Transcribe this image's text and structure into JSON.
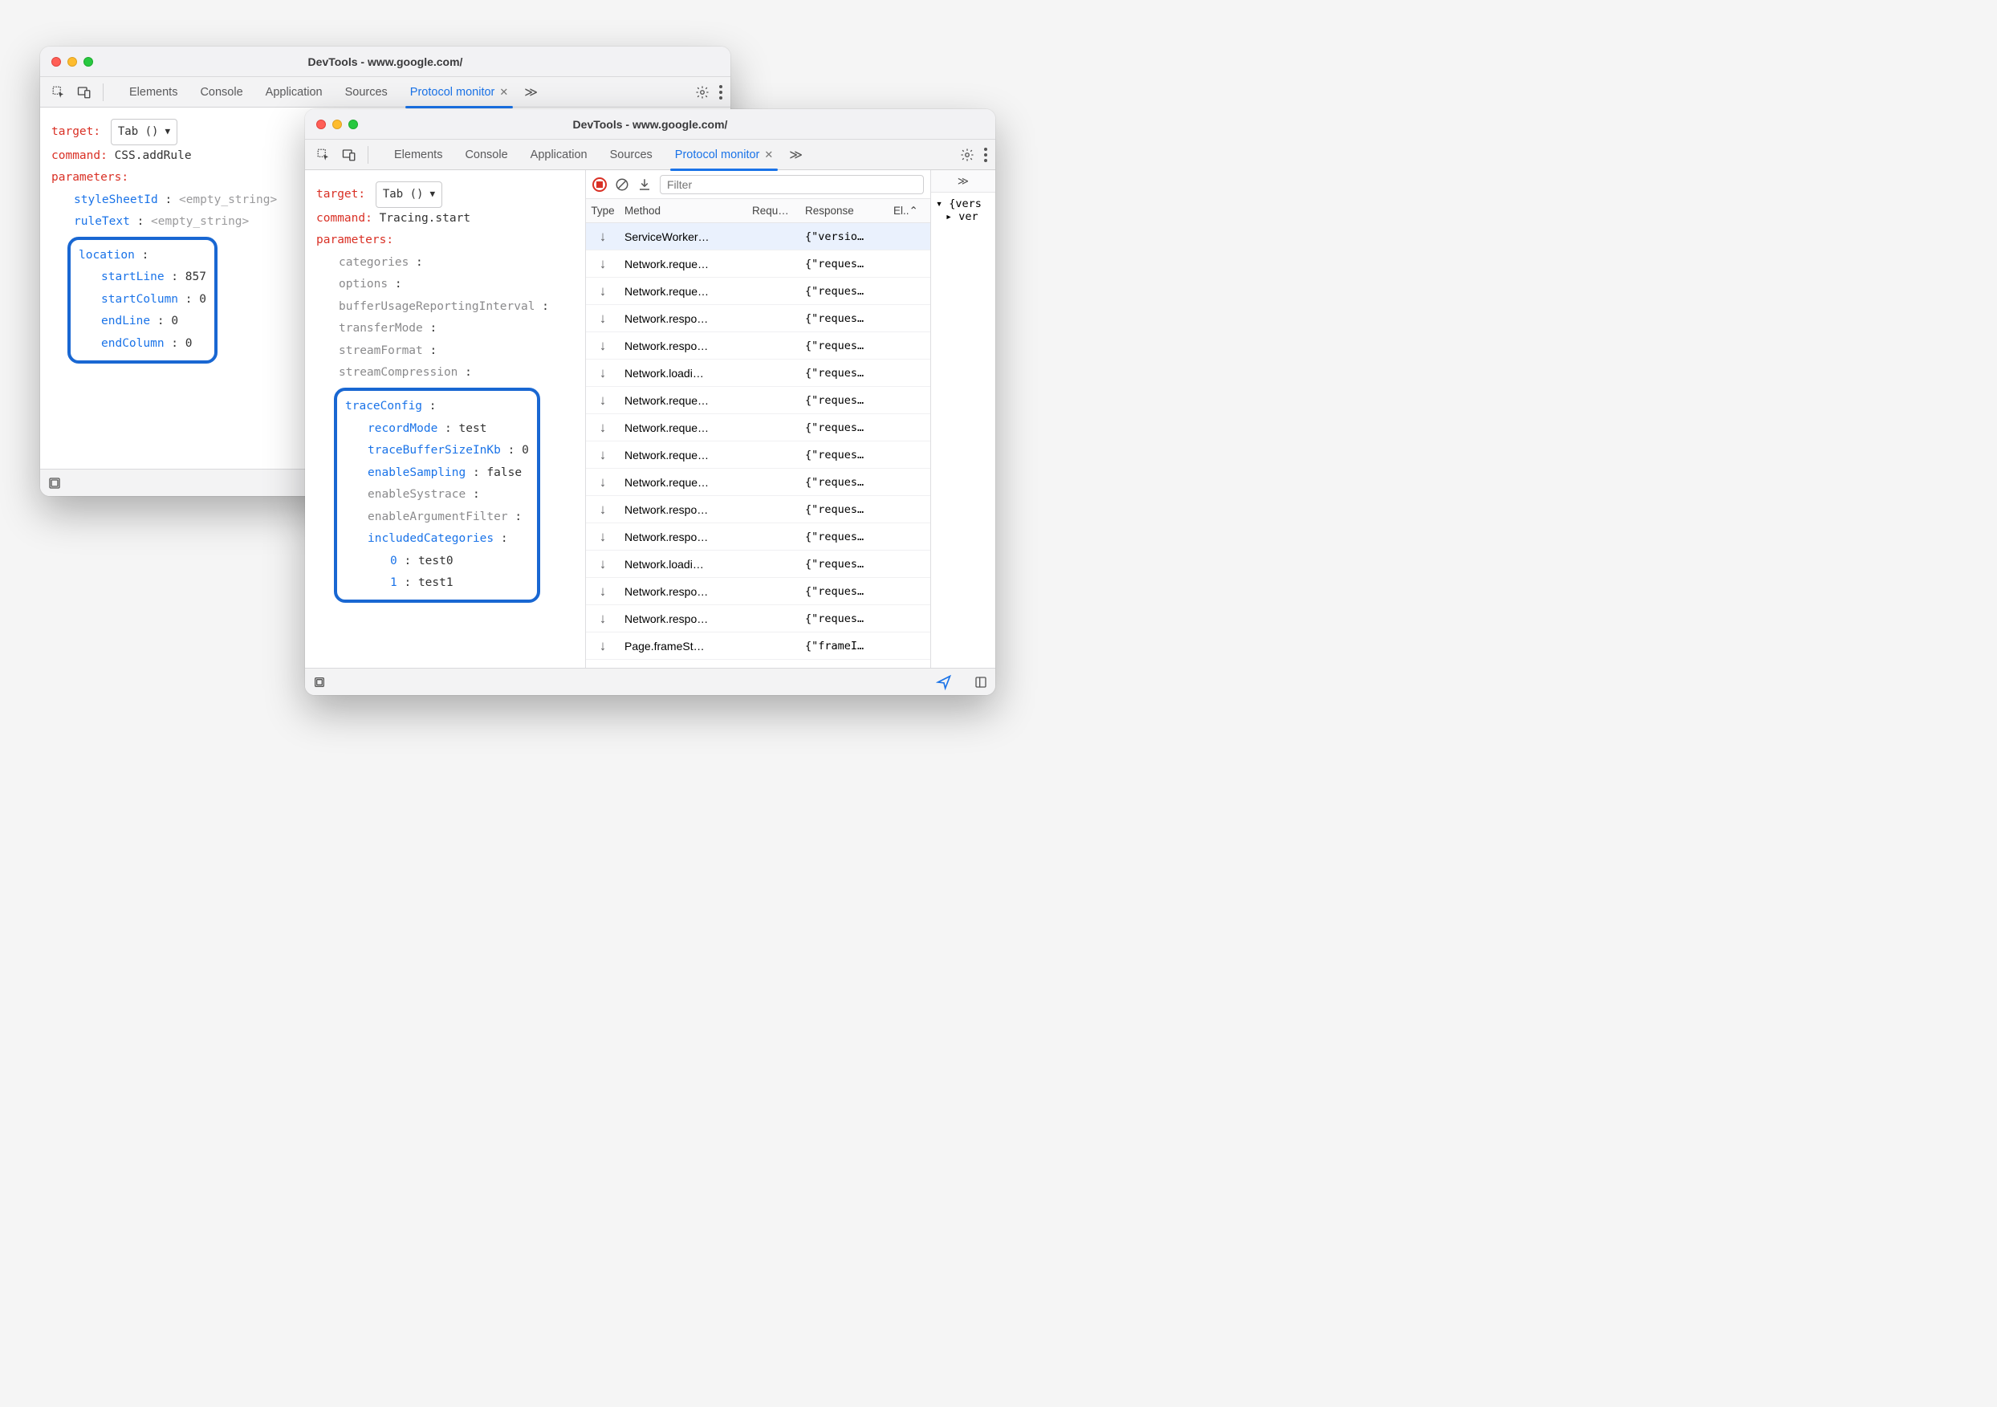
{
  "colors": {
    "accent": "#1a73e8",
    "danger": "#d93025",
    "highlight_border": "#1967d2"
  },
  "windowA": {
    "title": "DevTools - www.google.com/",
    "tabs": [
      "Elements",
      "Console",
      "Application",
      "Sources",
      "Protocol monitor"
    ],
    "active_tab": "Protocol monitor",
    "target_label": "target",
    "target_value": "Tab ()",
    "command_label": "command",
    "command_value": "CSS.addRule",
    "parameters_label": "parameters",
    "params_flat": [
      {
        "key": "styleSheetId",
        "value": "<empty_string>",
        "empty": true
      },
      {
        "key": "ruleText",
        "value": "<empty_string>",
        "empty": true
      }
    ],
    "highlight_key": "location",
    "highlight_props": [
      {
        "key": "startLine",
        "value": "857"
      },
      {
        "key": "startColumn",
        "value": "0"
      },
      {
        "key": "endLine",
        "value": "0"
      },
      {
        "key": "endColumn",
        "value": "0"
      }
    ]
  },
  "windowB": {
    "title": "DevTools - www.google.com/",
    "tabs": [
      "Elements",
      "Console",
      "Application",
      "Sources",
      "Protocol monitor"
    ],
    "active_tab": "Protocol monitor",
    "target_label": "target",
    "target_value": "Tab ()",
    "command_label": "command",
    "command_value": "Tracing.start",
    "parameters_label": "parameters",
    "params_flat": [
      {
        "key": "categories",
        "value": "",
        "gray": true
      },
      {
        "key": "options",
        "value": "",
        "gray": true
      },
      {
        "key": "bufferUsageReportingInterval",
        "value": "",
        "gray": true
      },
      {
        "key": "transferMode",
        "value": "",
        "gray": true
      },
      {
        "key": "streamFormat",
        "value": "",
        "gray": true
      },
      {
        "key": "streamCompression",
        "value": "",
        "gray": true
      }
    ],
    "highlight_key": "traceConfig",
    "highlight_props": [
      {
        "key": "recordMode",
        "value": "test"
      },
      {
        "key": "traceBufferSizeInKb",
        "value": "0"
      },
      {
        "key": "enableSampling",
        "value": "false"
      },
      {
        "key": "enableSystrace",
        "value": "",
        "gray": true
      },
      {
        "key": "enableArgumentFilter",
        "value": "",
        "gray": true
      },
      {
        "key": "includedCategories",
        "value": ""
      }
    ],
    "included_categories": [
      {
        "idx": "0",
        "val": "test0"
      },
      {
        "idx": "1",
        "val": "test1"
      }
    ],
    "filter_placeholder": "Filter",
    "columns": {
      "type": "Type",
      "method": "Method",
      "request": "Requ…",
      "response": "Response",
      "elapsed": "El..⌃"
    },
    "rows": [
      {
        "method": "ServiceWorker…",
        "response": "{\"versio…",
        "selected": true
      },
      {
        "method": "Network.reque…",
        "response": "{\"reques…"
      },
      {
        "method": "Network.reque…",
        "response": "{\"reques…"
      },
      {
        "method": "Network.respo…",
        "response": "{\"reques…"
      },
      {
        "method": "Network.respo…",
        "response": "{\"reques…"
      },
      {
        "method": "Network.loadi…",
        "response": "{\"reques…"
      },
      {
        "method": "Network.reque…",
        "response": "{\"reques…"
      },
      {
        "method": "Network.reque…",
        "response": "{\"reques…"
      },
      {
        "method": "Network.reque…",
        "response": "{\"reques…"
      },
      {
        "method": "Network.reque…",
        "response": "{\"reques…"
      },
      {
        "method": "Network.respo…",
        "response": "{\"reques…"
      },
      {
        "method": "Network.respo…",
        "response": "{\"reques…"
      },
      {
        "method": "Network.loadi…",
        "response": "{\"reques…"
      },
      {
        "method": "Network.respo…",
        "response": "{\"reques…"
      },
      {
        "method": "Network.respo…",
        "response": "{\"reques…"
      },
      {
        "method": "Page.frameSt…",
        "response": "{\"frameI…"
      }
    ],
    "tree": {
      "root": "{vers",
      "child": "ver"
    }
  }
}
